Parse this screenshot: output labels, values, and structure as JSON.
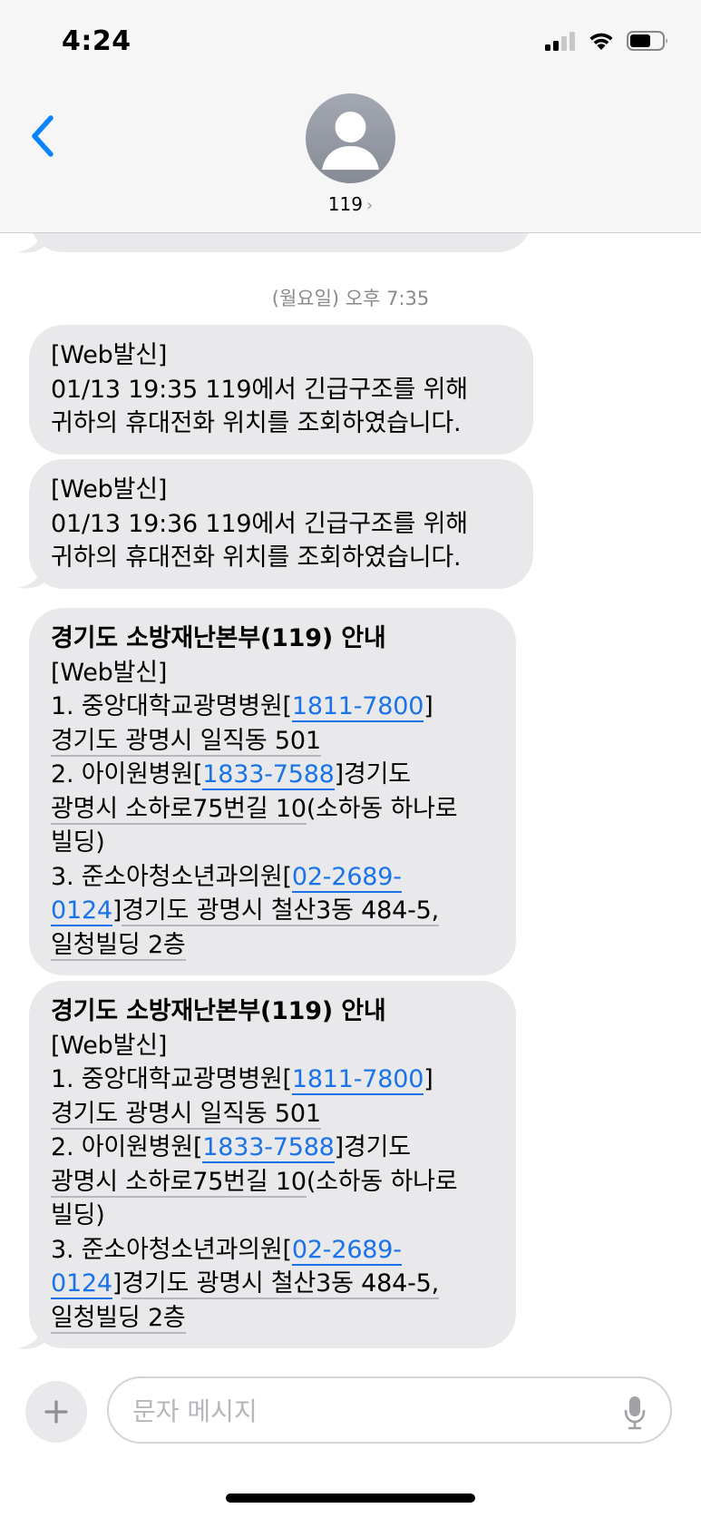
{
  "status_bar": {
    "time": "4:24",
    "icons": [
      "signal-icon",
      "wifi-icon",
      "battery-icon"
    ]
  },
  "header": {
    "back_icon": "chevron-left-icon",
    "contact_name": "119",
    "contact_chevron": "›"
  },
  "conversation": {
    "timestamp": "(월요일) 오후 7:35",
    "messages": [
      {
        "lines": [
          "[Web발신]",
          "01/13 19:35 119에서 긴급구조를 위해",
          "귀하의 휴대전화 위치를 조회하였습니다."
        ]
      },
      {
        "lines": [
          "[Web발신]",
          "01/13 19:36 119에서 긴급구조를 위해",
          "귀하의 휴대전화 위치를 조회하였습니다."
        ]
      },
      {
        "title": "경기도 소방재난본부(119) 안내",
        "web": "[Web발신]",
        "h1_name": "1. 중앙대학교광명병원[",
        "h1_phone": "1811-7800",
        "h1_close": "]",
        "h1_addr": "경기도 광명시 일직동 501",
        "h2_name": "2. 아이원병원[",
        "h2_phone": "1833-7588",
        "h2_close": "]경기도",
        "h2_addr1": "광명시 소하로75번길 10",
        "h2_addr2": "(소하동 하나로",
        "h2_addr3": "빌딩)",
        "h3_name": "3. 준소아청소년과의원[",
        "h3_phone1": "02-2689-",
        "h3_phone2": "0124",
        "h3_close": "]",
        "h3_addr1": "경기도 광명시 철산3동 484-5,",
        "h3_addr2": "일청빌딩 2층"
      },
      {
        "title": "경기도 소방재난본부(119) 안내",
        "web": "[Web발신]",
        "h1_name": "1. 중앙대학교광명병원[",
        "h1_phone": "1811-7800",
        "h1_close": "]",
        "h1_addr": "경기도 광명시 일직동 501",
        "h2_name": "2. 아이원병원[",
        "h2_phone": "1833-7588",
        "h2_close": "]경기도",
        "h2_addr1": "광명시 소하로75번길 10",
        "h2_addr2": "(소하동 하나로",
        "h2_addr3": "빌딩)",
        "h3_name": "3. 준소아청소년과의원[",
        "h3_phone1": "02-2689-",
        "h3_phone2": "0124",
        "h3_close": "]",
        "h3_addr1": "경기도 광명시 철산3동 484-5,",
        "h3_addr2": "일청빌딩 2층"
      }
    ]
  },
  "composer": {
    "plus_icon": "plus-icon",
    "placeholder": "문자 메시지",
    "mic_icon": "microphone-icon"
  },
  "colors": {
    "bubble_received": "#e9e9eb",
    "link": "#1a73e8",
    "ios_blue": "#0a84ff",
    "timestamp": "#8a8a8e"
  }
}
